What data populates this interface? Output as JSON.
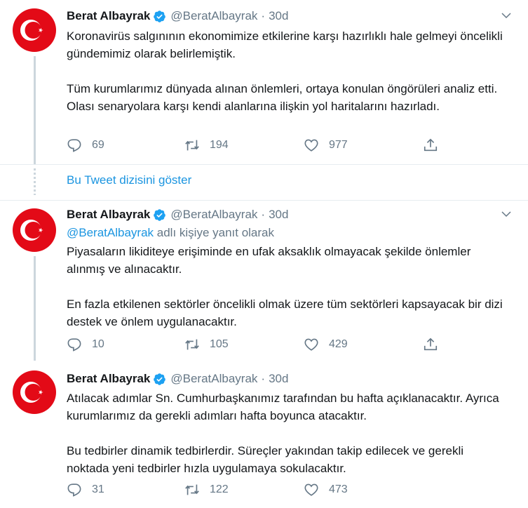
{
  "tweets": [
    {
      "name": "Berat Albayrak",
      "handle": "@BeratAlbayrak",
      "separator": "·",
      "time": "30d",
      "paragraphs": [
        "Koronavirüs salgınının ekonomimize etkilerine karşı hazırlıklı hale gelmeyi öncelikli gündemimiz olarak belirlemiştik.",
        "Tüm kurumlarımız dünyada alınan önlemleri, ortaya konulan öngörüleri analiz etti. Olası senaryolara karşı kendi alanlarına ilişkin yol haritalarını hazırladı."
      ],
      "replies": "69",
      "retweets": "194",
      "likes": "977"
    },
    {
      "name": "Berat Albayrak",
      "handle": "@BeratAlbayrak",
      "separator": "·",
      "time": "30d",
      "reply_mention": "@BeratAlbayrak",
      "reply_suffix": " adlı kişiye yanıt olarak",
      "paragraphs": [
        "Piyasaların likiditeye erişiminde en ufak aksaklık olmayacak şekilde önlemler alınmış ve alınacaktır.",
        "En fazla etkilenen sektörler öncelikli olmak üzere tüm sektörleri kapsayacak bir dizi destek ve önlem uygulanacaktır."
      ],
      "replies": "10",
      "retweets": "105",
      "likes": "429"
    },
    {
      "name": "Berat Albayrak",
      "handle": "@BeratAlbayrak",
      "separator": "·",
      "time": "30d",
      "paragraphs": [
        "Atılacak adımlar Sn. Cumhurbaşkanımız tarafından bu hafta açıklanacaktır. Ayrıca kurumlarımız da gerekli adımları hafta boyunca atacaktır.",
        "Bu tedbirler dinamik tedbirlerdir. Süreçler yakından takip edilecek ve gerekli noktada yeni tedbirler hızla uygulamaya sokulacaktır."
      ],
      "replies": "31",
      "retweets": "122",
      "likes": "473"
    }
  ],
  "show_thread_label": "Bu Tweet dizisini göster",
  "icons": {
    "avatar": "turkish-flag-icon",
    "verified": "verified-badge-icon",
    "caret": "chevron-down-icon",
    "reply": "reply-icon",
    "retweet": "retweet-icon",
    "like": "heart-icon",
    "share": "share-icon"
  },
  "colors": {
    "flag_red": "#e30a17",
    "link_blue": "#1b95e0",
    "muted": "#657786",
    "verified_blue": "#1da1f2"
  }
}
